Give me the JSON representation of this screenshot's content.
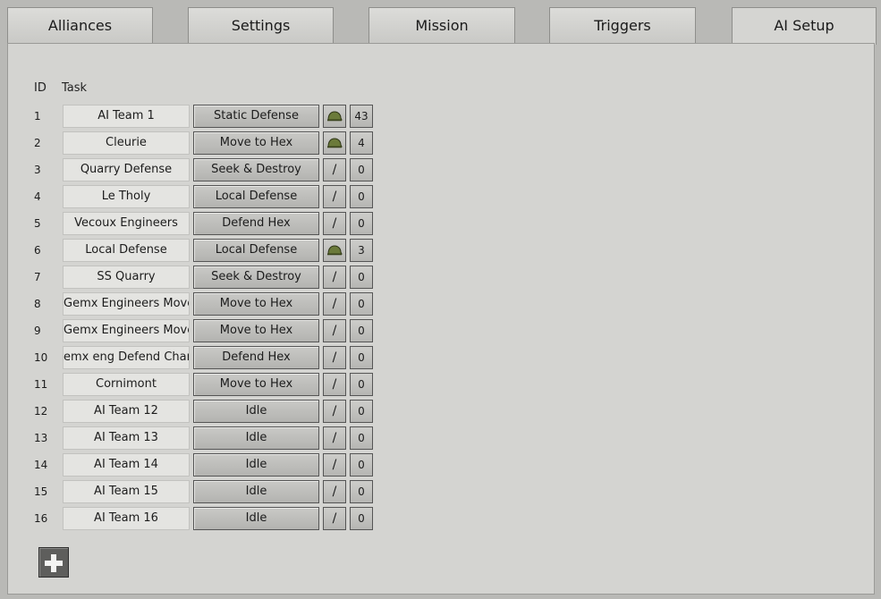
{
  "tabs": [
    {
      "label": "Alliances",
      "active": false
    },
    {
      "label": "Settings",
      "active": false
    },
    {
      "label": "Mission",
      "active": false
    },
    {
      "label": "Triggers",
      "active": false
    },
    {
      "label": "AI Setup",
      "active": true
    }
  ],
  "table": {
    "headers": {
      "id": "ID",
      "task": "Task"
    },
    "rows": [
      {
        "id": "1",
        "name": "AI Team 1",
        "task": "Static Defense",
        "icon": "helmet-icon",
        "icon_text": "",
        "value": "43"
      },
      {
        "id": "2",
        "name": "Cleurie",
        "task": "Move to Hex",
        "icon": "helmet-icon",
        "icon_text": "",
        "value": "4"
      },
      {
        "id": "3",
        "name": "Quarry Defense",
        "task": "Seek & Destroy",
        "icon": "slash-icon",
        "icon_text": "/",
        "value": "0"
      },
      {
        "id": "4",
        "name": "Le Tholy",
        "task": "Local Defense",
        "icon": "slash-icon",
        "icon_text": "/",
        "value": "0"
      },
      {
        "id": "5",
        "name": "Vecoux Engineers",
        "task": "Defend Hex",
        "icon": "slash-icon",
        "icon_text": "/",
        "value": "0"
      },
      {
        "id": "6",
        "name": "Local Defense",
        "task": "Local Defense",
        "icon": "helmet-icon",
        "icon_text": "",
        "value": "3"
      },
      {
        "id": "7",
        "name": "SS Quarry",
        "task": "Seek & Destroy",
        "icon": "slash-icon",
        "icon_text": "/",
        "value": "0"
      },
      {
        "id": "8",
        "name": "Gemx Engineers Move I",
        "task": "Move to Hex",
        "icon": "slash-icon",
        "icon_text": "/",
        "value": "0"
      },
      {
        "id": "9",
        "name": "Gemx Engineers Move I",
        "task": "Move to Hex",
        "icon": "slash-icon",
        "icon_text": "/",
        "value": "0"
      },
      {
        "id": "10",
        "name": "emx eng Defend Champ",
        "task": "Defend Hex",
        "icon": "slash-icon",
        "icon_text": "/",
        "value": "0"
      },
      {
        "id": "11",
        "name": "Cornimont",
        "task": "Move to Hex",
        "icon": "slash-icon",
        "icon_text": "/",
        "value": "0"
      },
      {
        "id": "12",
        "name": "AI Team 12",
        "task": "Idle",
        "icon": "slash-icon",
        "icon_text": "/",
        "value": "0"
      },
      {
        "id": "13",
        "name": "AI Team 13",
        "task": "Idle",
        "icon": "slash-icon",
        "icon_text": "/",
        "value": "0"
      },
      {
        "id": "14",
        "name": "AI Team 14",
        "task": "Idle",
        "icon": "slash-icon",
        "icon_text": "/",
        "value": "0"
      },
      {
        "id": "15",
        "name": "AI Team 15",
        "task": "Idle",
        "icon": "slash-icon",
        "icon_text": "/",
        "value": "0"
      },
      {
        "id": "16",
        "name": "AI Team 16",
        "task": "Idle",
        "icon": "slash-icon",
        "icon_text": "/",
        "value": "0"
      }
    ]
  },
  "add_button": {
    "icon": "plus-icon"
  },
  "colors": {
    "helmet": "#6b7a3a",
    "panel": "#d4d4d1"
  }
}
